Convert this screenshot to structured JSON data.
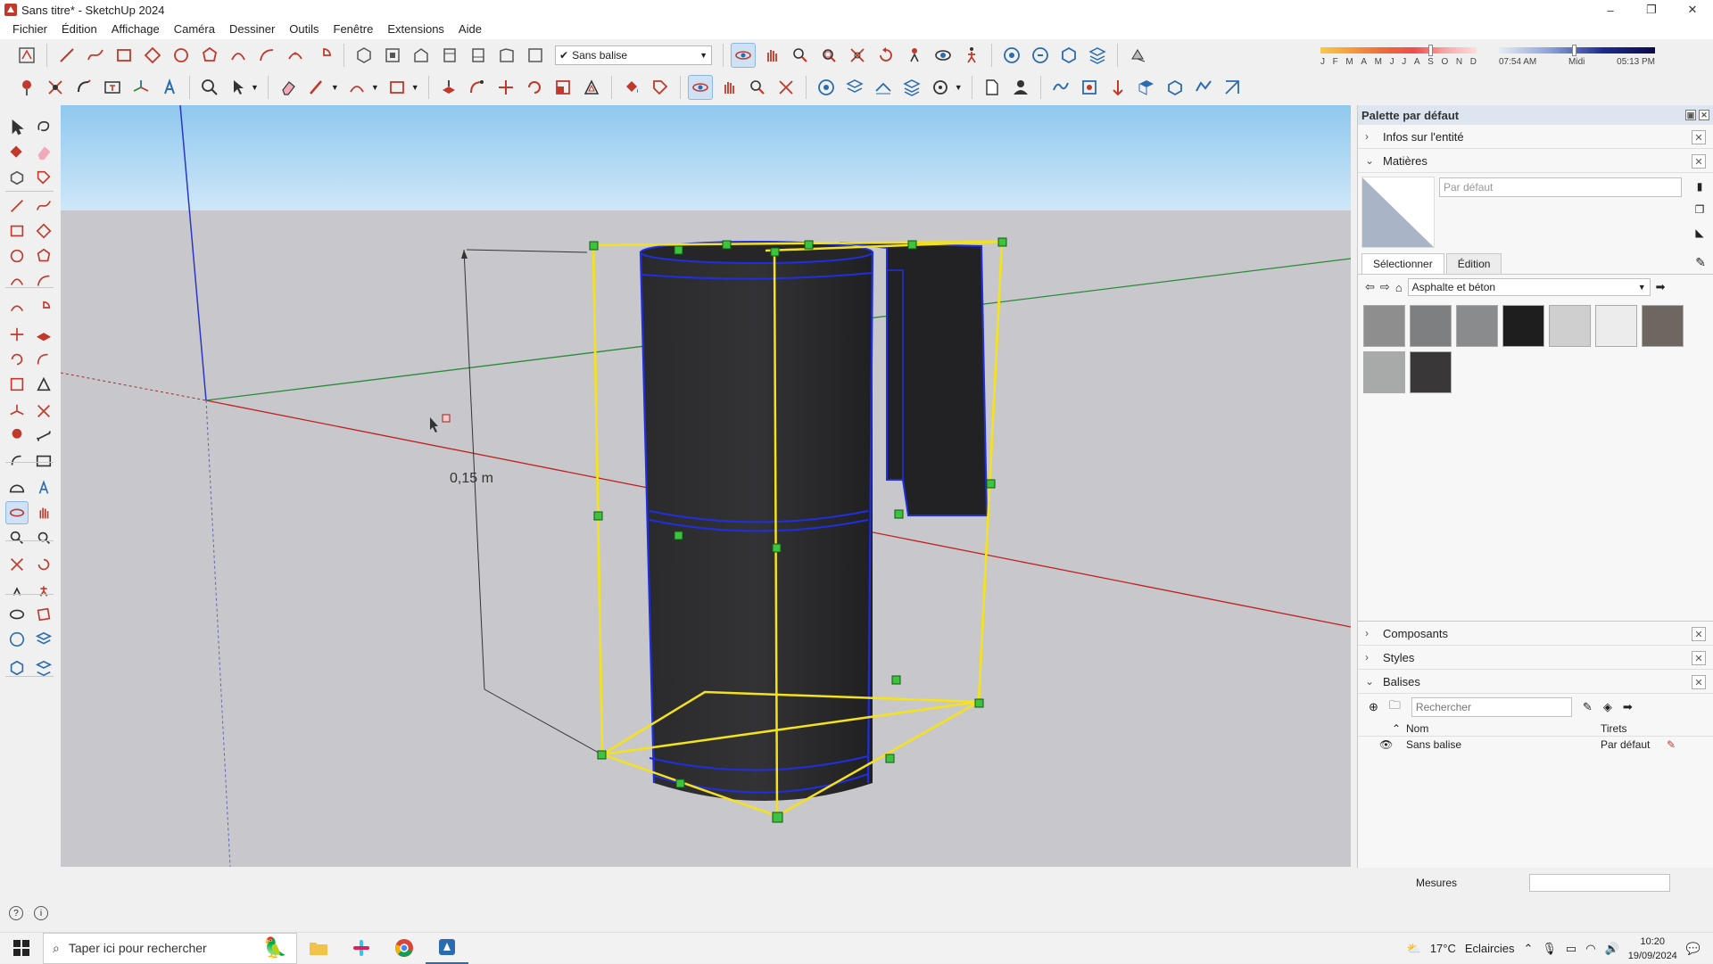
{
  "window": {
    "title": "Sans titre* - SketchUp 2024",
    "minimize": "–",
    "maximize": "❐",
    "close": "✕"
  },
  "menu": [
    "Fichier",
    "Édition",
    "Affichage",
    "Caméra",
    "Dessiner",
    "Outils",
    "Fenêtre",
    "Extensions",
    "Aide"
  ],
  "toolbar": {
    "tag_selected": "Sans balise"
  },
  "shadows": {
    "months": [
      "J",
      "F",
      "M",
      "A",
      "M",
      "J",
      "J",
      "A",
      "S",
      "O",
      "N",
      "D"
    ],
    "time_start": "07:54 AM",
    "time_mid": "Midi",
    "time_end": "05:13 PM",
    "month_level": 0.7,
    "time_level": 0.48
  },
  "viewport": {
    "dimension_label": "0,15 m"
  },
  "tray": {
    "title": "Palette par défaut",
    "entity_info": "Infos sur l'entité",
    "materials": {
      "title": "Matières",
      "name_placeholder": "Par défaut",
      "tab_select": "Sélectionner",
      "tab_edit": "Édition",
      "library": "Asphalte et béton",
      "swatches": [
        "#8e8e8e",
        "#7d7f80",
        "#8a8b8c",
        "#1e1e1f",
        "#cfcfcf",
        "#ececec",
        "#6e6660",
        "#a7aaa8",
        "#3a3738"
      ]
    },
    "components": "Composants",
    "styles": "Styles",
    "tags": {
      "title": "Balises",
      "search_placeholder": "Rechercher",
      "col_name": "Nom",
      "col_dashes": "Tirets",
      "rows": [
        {
          "name": "Sans balise",
          "dashes": "Par défaut"
        }
      ]
    }
  },
  "measurements": {
    "label": "Mesures"
  },
  "taskbar": {
    "search": "Taper ici pour rechercher",
    "weather_temp": "17°C",
    "weather_desc": "Eclaircies",
    "time": "10:20",
    "date": "19/09/2024"
  }
}
